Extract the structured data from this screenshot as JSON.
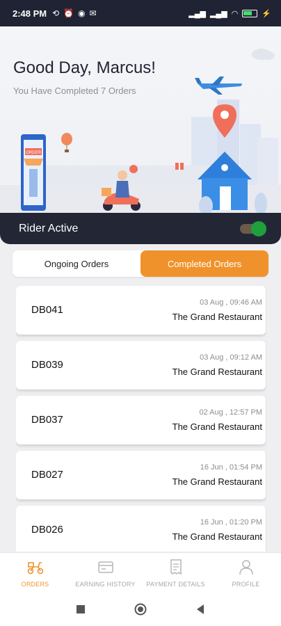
{
  "status_bar": {
    "time": "2:48 PM",
    "battery": "67"
  },
  "hero": {
    "greeting": "Good Day, Marcus!",
    "subtitle": "You Have Completed  7 Orders",
    "store_sign": "ORDER"
  },
  "rider": {
    "label": "Rider Active",
    "active": true
  },
  "tabs": [
    {
      "label": "Ongoing Orders",
      "active": false
    },
    {
      "label": "Completed Orders",
      "active": true
    }
  ],
  "orders": [
    {
      "id": "DB041",
      "datetime": "03 Aug , 09:46 AM",
      "restaurant": "The Grand Restaurant"
    },
    {
      "id": "DB039",
      "datetime": "03 Aug , 09:12 AM",
      "restaurant": "The Grand Restaurant"
    },
    {
      "id": "DB037",
      "datetime": "02 Aug , 12:57 PM",
      "restaurant": "The Grand Restaurant"
    },
    {
      "id": "DB027",
      "datetime": "16 Jun , 01:54 PM",
      "restaurant": "The Grand Restaurant"
    },
    {
      "id": "DB026",
      "datetime": "16 Jun , 01:20 PM",
      "restaurant": "The Grand Restaurant"
    }
  ],
  "bottom_nav": [
    {
      "label": "ORDERS",
      "icon": "scooter-icon",
      "active": true
    },
    {
      "label": "EARNING HISTORY",
      "icon": "wallet-icon",
      "active": false
    },
    {
      "label": "PAYMENT DETAILS",
      "icon": "receipt-icon",
      "active": false
    },
    {
      "label": "PROFILE",
      "icon": "person-icon",
      "active": false
    }
  ],
  "colors": {
    "accent": "#f0922c",
    "dark": "#232735",
    "toggle_on": "#1ea03d"
  }
}
